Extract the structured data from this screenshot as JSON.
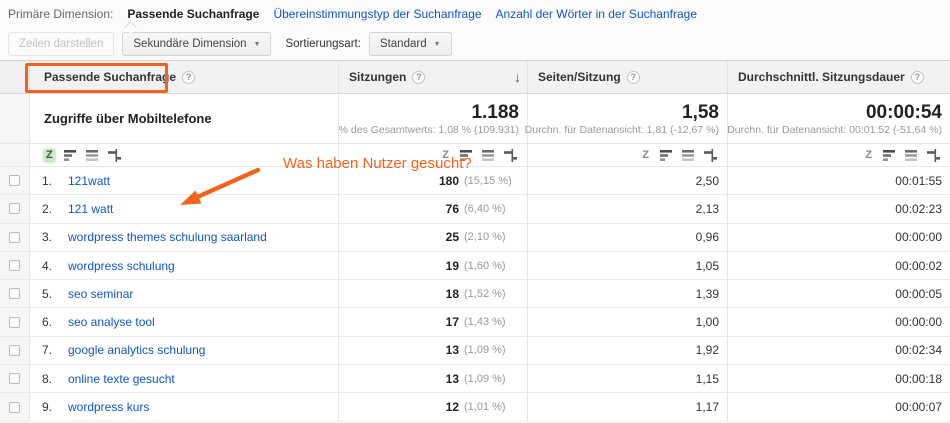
{
  "colors": {
    "accent_orange": "#f4631e",
    "link_blue": "#1155cc",
    "header_bg": "#f2f2f2",
    "active_sort_green": "#cfe6cb"
  },
  "dimension_bar": {
    "label": "Primäre Dimension:",
    "selected": "Passende Suchanfrage",
    "link1": "Übereinstimmungstyp der Suchanfrage",
    "link2": "Anzahl der Wörter in der Suchanfrage"
  },
  "toolbar": {
    "plot_rows": "Zeilen darstellen",
    "secondary_dimension": "Sekundäre Dimension",
    "sort_type_label": "Sortierungsart:",
    "sort_type_value": "Standard"
  },
  "annotation": {
    "text": "Was haben Nutzer gesucht?"
  },
  "table": {
    "columns": [
      {
        "label": "Passende Suchanfrage"
      },
      {
        "label": "Sitzungen",
        "sort": "desc"
      },
      {
        "label": "Seiten/Sitzung"
      },
      {
        "label": "Durchschnittl. Sitzungsdauer"
      }
    ],
    "summary": {
      "title": "Zugriffe über Mobiltelefone",
      "sessions_value": "1.188",
      "sessions_sub": "% des Gesamtwerts: 1,08 % (109.931)",
      "pages_value": "1,58",
      "pages_sub": "Durchn. für Datenansicht: 1,81 (-12,67 %)",
      "duration_value": "00:00:54",
      "duration_sub": "Durchn. für Datenansicht: 00:01:52 (-51,64 %)"
    },
    "rows": [
      {
        "index": "1.",
        "query": "121watt",
        "sessions": "180",
        "sessions_pct": "(15,15 %)",
        "pages": "2,50",
        "duration": "00:01:55"
      },
      {
        "index": "2.",
        "query": "121 watt",
        "sessions": "76",
        "sessions_pct": "(6,40 %)",
        "pages": "2,13",
        "duration": "00:02:23"
      },
      {
        "index": "3.",
        "query": "wordpress themes schulung saarland",
        "sessions": "25",
        "sessions_pct": "(2,10 %)",
        "pages": "0,96",
        "duration": "00:00:00"
      },
      {
        "index": "4.",
        "query": "wordpress schulung",
        "sessions": "19",
        "sessions_pct": "(1,60 %)",
        "pages": "1,05",
        "duration": "00:00:02"
      },
      {
        "index": "5.",
        "query": "seo seminar",
        "sessions": "18",
        "sessions_pct": "(1,52 %)",
        "pages": "1,39",
        "duration": "00:00:05"
      },
      {
        "index": "6.",
        "query": "seo analyse tool",
        "sessions": "17",
        "sessions_pct": "(1,43 %)",
        "pages": "1,00",
        "duration": "00:00:00"
      },
      {
        "index": "7.",
        "query": "google analytics schulung",
        "sessions": "13",
        "sessions_pct": "(1,09 %)",
        "pages": "1,92",
        "duration": "00:02:34"
      },
      {
        "index": "8.",
        "query": "online texte gesucht",
        "sessions": "13",
        "sessions_pct": "(1,09 %)",
        "pages": "1,15",
        "duration": "00:00:18"
      },
      {
        "index": "9.",
        "query": "wordpress kurs",
        "sessions": "12",
        "sessions_pct": "(1,01 %)",
        "pages": "1,17",
        "duration": "00:00:07"
      }
    ]
  }
}
